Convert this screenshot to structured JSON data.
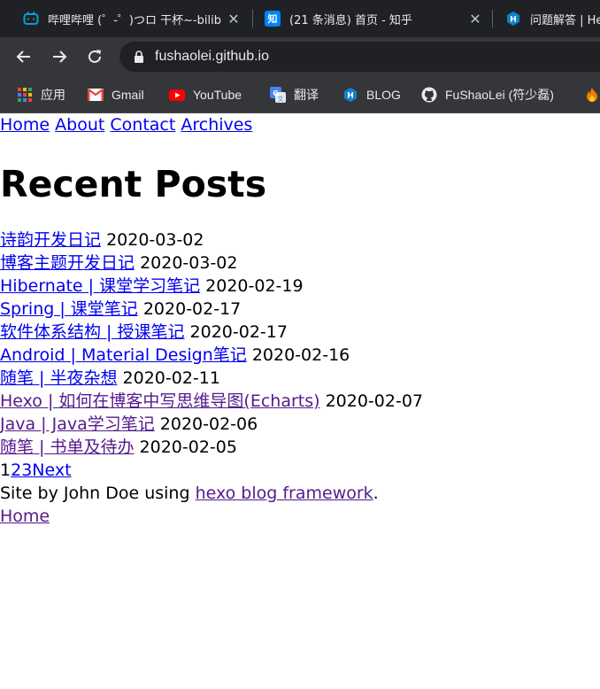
{
  "browser": {
    "tabs": [
      {
        "title": "哔哩哔哩 (゜-゜)つロ 干杯~-bilibili",
        "icon": "bilibili-icon"
      },
      {
        "title": "(21 条消息) 首页 - 知乎",
        "icon": "zhihu-icon"
      },
      {
        "title": "问题解答 | Hexo",
        "icon": "hexo-icon"
      }
    ],
    "address": "fushaolei.github.io",
    "bookmarks": [
      {
        "label": "应用",
        "icon": "apps-grid-icon"
      },
      {
        "label": "Gmail",
        "icon": "gmail-icon"
      },
      {
        "label": "YouTube",
        "icon": "youtube-icon"
      },
      {
        "label": "翻译",
        "icon": "translate-icon"
      },
      {
        "label": "BLOG",
        "icon": "hexo-icon"
      },
      {
        "label": "FuShaoLei (符少磊)",
        "icon": "github-icon"
      }
    ]
  },
  "nav": {
    "home": "Home",
    "about": "About",
    "contact": "Contact",
    "archives": "Archives"
  },
  "heading": "Recent Posts",
  "posts": [
    {
      "title": "诗韵开发日记",
      "date": "2020-03-02"
    },
    {
      "title": "博客主题开发日记",
      "date": "2020-03-02"
    },
    {
      "title": "Hibernate | 课堂学习笔记",
      "date": "2020-02-19"
    },
    {
      "title": "Spring | 课堂笔记",
      "date": "2020-02-17"
    },
    {
      "title": "软件体系结构 | 授课笔记",
      "date": "2020-02-17"
    },
    {
      "title": "Android | Material Design笔记",
      "date": "2020-02-16"
    },
    {
      "title": "随笔 | 半夜杂想",
      "date": "2020-02-11"
    },
    {
      "title": "Hexo | 如何在博客中写思维导图(Echarts)",
      "date": "2020-02-07"
    },
    {
      "title": "Java | Java学习笔记",
      "date": "2020-02-06"
    },
    {
      "title": "随笔 | 书单及待办",
      "date": "2020-02-05"
    }
  ],
  "pagination": {
    "current": "1",
    "pages": [
      "2",
      "3"
    ],
    "next": "Next"
  },
  "footer": {
    "prefix": "Site by John Doe using ",
    "link": "hexo blog framework",
    "suffix": ".",
    "home": "Home"
  },
  "colors": {
    "link": "#0000ee",
    "visited_link": "#551a8b",
    "tabstrip": "#202124",
    "toolbar": "#35363a"
  }
}
